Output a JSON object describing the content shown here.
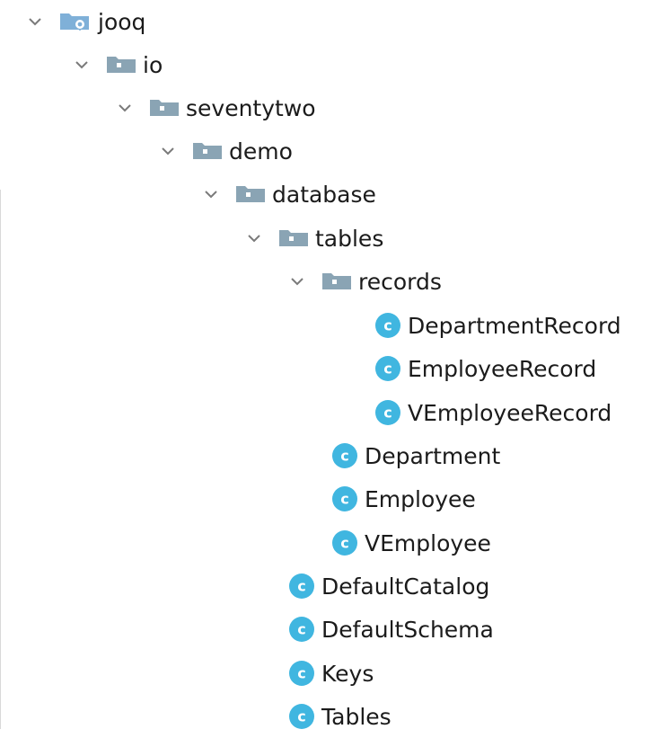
{
  "tree": {
    "jooq": "jooq",
    "io": "io",
    "seventytwo": "seventytwo",
    "demo": "demo",
    "database": "database",
    "tables": "tables",
    "records": "records",
    "department_record": "DepartmentRecord",
    "employee_record": "EmployeeRecord",
    "vemployee_record": "VEmployeeRecord",
    "department": "Department",
    "employee": "Employee",
    "vemployee": "VEmployee",
    "default_catalog": "DefaultCatalog",
    "default_schema": "DefaultSchema",
    "keys": "Keys",
    "tables_class": "Tables"
  },
  "icons": {
    "expand": "chevron-down-icon",
    "package": "package-folder-icon",
    "resource": "resource-folder-icon",
    "class": "class-c-icon"
  },
  "colors": {
    "folder": "#8aa4b4",
    "resource_folder": "#7fb0d8",
    "class_badge": "#40b6e0",
    "class_letter": "#ffffff",
    "chevron": "#7a7a7a",
    "text": "#1b1b1b"
  }
}
